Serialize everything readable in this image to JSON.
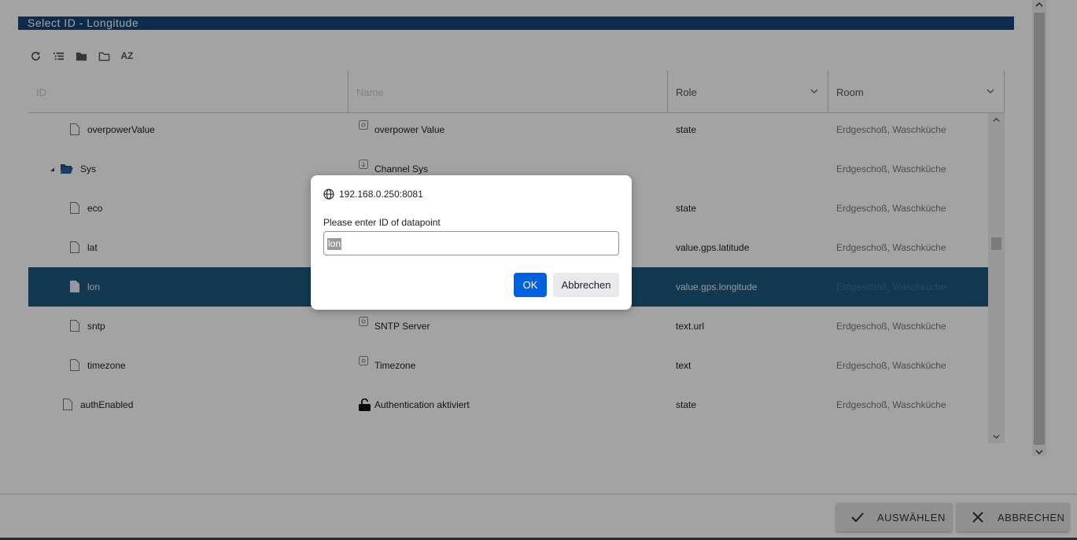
{
  "dialog": {
    "title": "Select ID - Longitude"
  },
  "toolbar": {
    "icons": [
      "refresh-icon",
      "list-icon",
      "folder-filled-icon",
      "folder-outline-icon",
      "sort-az-icon"
    ],
    "sort_label": "AZ"
  },
  "table": {
    "headers": {
      "id_placeholder": "ID",
      "name_placeholder": "Name",
      "role": "Role",
      "room": "Room"
    },
    "rows": [
      {
        "id": "overpowerValue",
        "name": "overpower Value",
        "role": "state",
        "room": "Erdgeschoß, Waschküche",
        "icon": "file-icon",
        "name_icon": "state-icon"
      },
      {
        "id": "Sys",
        "name": "Channel Sys",
        "role": "",
        "room": "Erdgeschoß, Waschküche",
        "icon": "folder-open-icon",
        "name_icon": "channel-icon"
      },
      {
        "id": "eco",
        "name": "",
        "role": "state",
        "room": "Erdgeschoß, Waschküche",
        "icon": "file-icon",
        "name_icon": ""
      },
      {
        "id": "lat",
        "name": "",
        "role": "value.gps.latitude",
        "room": "Erdgeschoß, Waschküche",
        "icon": "file-icon",
        "name_icon": ""
      },
      {
        "id": "lon",
        "name": "",
        "role": "value.gps.longitude",
        "room": "Erdgeschoß, Waschküche",
        "icon": "file-icon",
        "name_icon": "",
        "selected": true
      },
      {
        "id": "sntp",
        "name": "SNTP Server",
        "role": "text.url",
        "room": "Erdgeschoß, Waschküche",
        "icon": "file-icon",
        "name_icon": "state-icon"
      },
      {
        "id": "timezone",
        "name": "Timezone",
        "role": "text",
        "room": "Erdgeschoß, Waschküche",
        "icon": "file-icon",
        "name_icon": "state-icon"
      },
      {
        "id": "authEnabled",
        "name": "Authentication aktiviert",
        "role": "state",
        "room": "Erdgeschoß, Waschküche",
        "icon": "file-icon",
        "name_icon": "unlock-icon"
      }
    ]
  },
  "footer": {
    "select_label": "AUSWÄHLEN",
    "cancel_label": "ABBRECHEN"
  },
  "prompt": {
    "origin": "192.168.0.250:8081",
    "message": "Please enter ID of datapoint",
    "value": "lon",
    "ok_label": "OK",
    "cancel_label": "Abbrechen"
  },
  "colors": {
    "title_bar": "#164477",
    "selected_row": "#1d5a7f",
    "ok_button": "#0061e0"
  }
}
